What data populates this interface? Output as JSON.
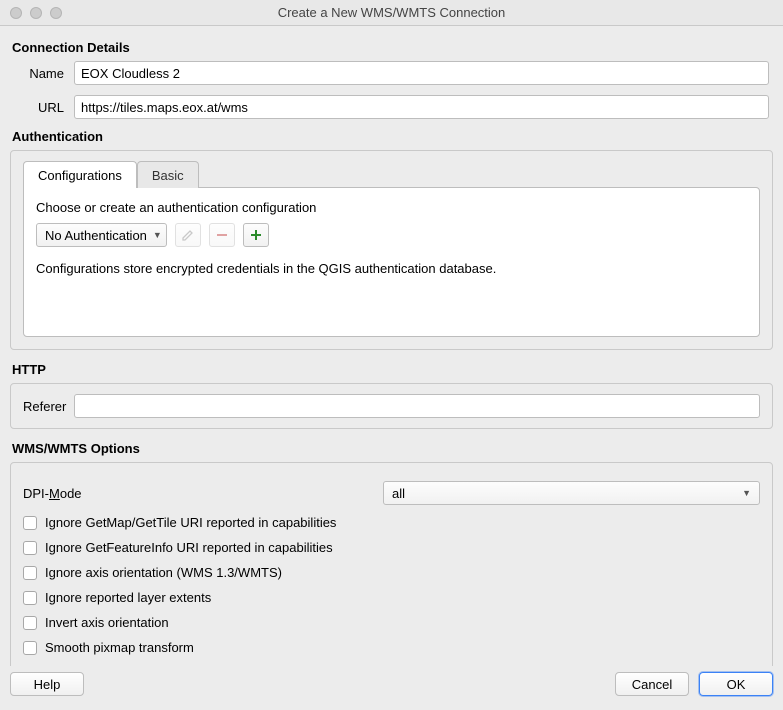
{
  "window": {
    "title": "Create a New WMS/WMTS Connection"
  },
  "connection_details": {
    "heading": "Connection Details",
    "name_label": "Name",
    "name_value": "EOX Cloudless 2",
    "url_label": "URL",
    "url_value": "https://tiles.maps.eox.at/wms"
  },
  "authentication": {
    "heading": "Authentication",
    "tabs": {
      "configurations": "Configurations",
      "basic": "Basic"
    },
    "choose_label": "Choose or create an authentication configuration",
    "selected": "No Authentication",
    "note": "Configurations store encrypted credentials in the QGIS authentication database."
  },
  "http": {
    "heading": "HTTP",
    "referer_label": "Referer",
    "referer_value": ""
  },
  "wms_options": {
    "heading": "WMS/WMTS Options",
    "dpi_mode_prefix": "DPI-",
    "dpi_mode_underlined": "M",
    "dpi_mode_suffix": "ode",
    "dpi_value": "all",
    "checks": {
      "ignore_getmap": "Ignore GetMap/GetTile URI reported in capabilities",
      "ignore_getfeatureinfo": "Ignore GetFeatureInfo URI reported in capabilities",
      "ignore_axis": "Ignore axis orientation (WMS 1.3/WMTS)",
      "ignore_extents": "Ignore reported layer extents",
      "invert_axis": "Invert axis orientation",
      "smooth_pixmap": "Smooth pixmap transform"
    }
  },
  "buttons": {
    "help": "Help",
    "cancel": "Cancel",
    "ok": "OK"
  }
}
